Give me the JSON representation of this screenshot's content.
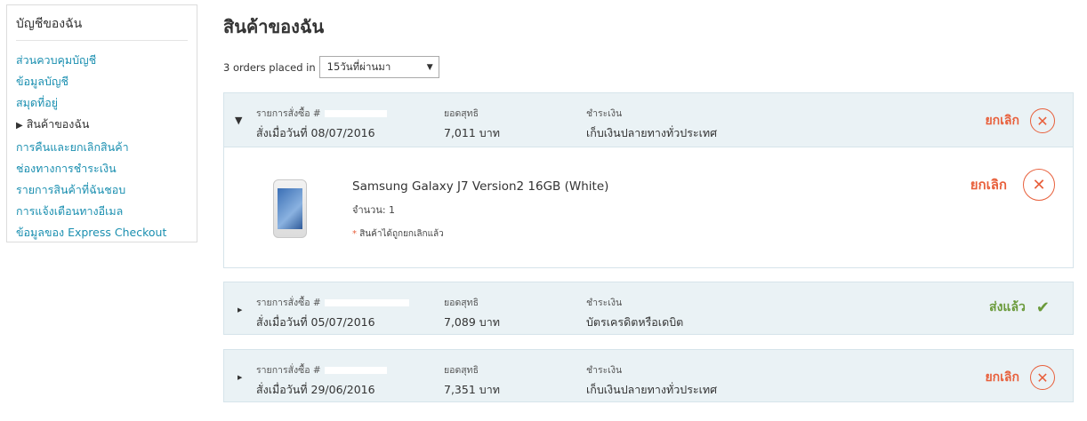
{
  "sidebar": {
    "title": "บัญชีของฉัน",
    "items": [
      {
        "label": "ส่วนควบคุมบัญชี"
      },
      {
        "label": "ข้อมูลบัญชี"
      },
      {
        "label": "สมุดที่อยู่"
      },
      {
        "label": "สินค้าของฉัน",
        "active": true
      },
      {
        "label": "การคืนและยกเลิกสินค้า"
      },
      {
        "label": "ช่องทางการชำระเงิน"
      },
      {
        "label": "รายการสินค้าที่ฉันชอบ"
      },
      {
        "label": "การแจ้งเตือนทางอีเมล"
      },
      {
        "label": "ข้อมูลของ Express Checkout"
      }
    ]
  },
  "main": {
    "title": "สินค้าของฉัน",
    "filter_prefix": "3 orders placed in",
    "filter_value": "15วันที่ผ่านมา"
  },
  "labels": {
    "order_no": "รายการสั่งซื้อ #",
    "total": "ยอดสุทธิ",
    "payment": "ชำระเงิน"
  },
  "orders": [
    {
      "date_text": "สั่งเมื่อวันที่ 08/07/2016",
      "total": "7,011 บาท",
      "payment": "เก็บเงินปลายทางทั่วประเทศ",
      "status": "ยกเลิก",
      "status_type": "cancel",
      "expanded": true,
      "item": {
        "name": "Samsung Galaxy J7 Version2 16GB (White)",
        "qty": "จำนวน: 1",
        "note": "สินค้าได้ถูกยกเลิกแล้ว",
        "status": "ยกเลิก"
      }
    },
    {
      "date_text": "สั่งเมื่อวันที่ 05/07/2016",
      "total": "7,089 บาท",
      "payment": "บัตรเครดิตหรือเดบิต",
      "status": "ส่งแล้ว",
      "status_type": "sent",
      "expanded": false
    },
    {
      "date_text": "สั่งเมื่อวันที่ 29/06/2016",
      "total": "7,351 บาท",
      "payment": "เก็บเงินปลายทางทั่วประเทศ",
      "status": "ยกเลิก",
      "status_type": "cancel",
      "expanded": false
    }
  ],
  "icons": {
    "cancel": "close-circle-icon",
    "sent": "check-icon"
  },
  "colors": {
    "link": "#1a8fb0",
    "cancel": "#e8603c",
    "sent": "#6a9a3a",
    "order_header_bg": "#eaf2f5"
  }
}
